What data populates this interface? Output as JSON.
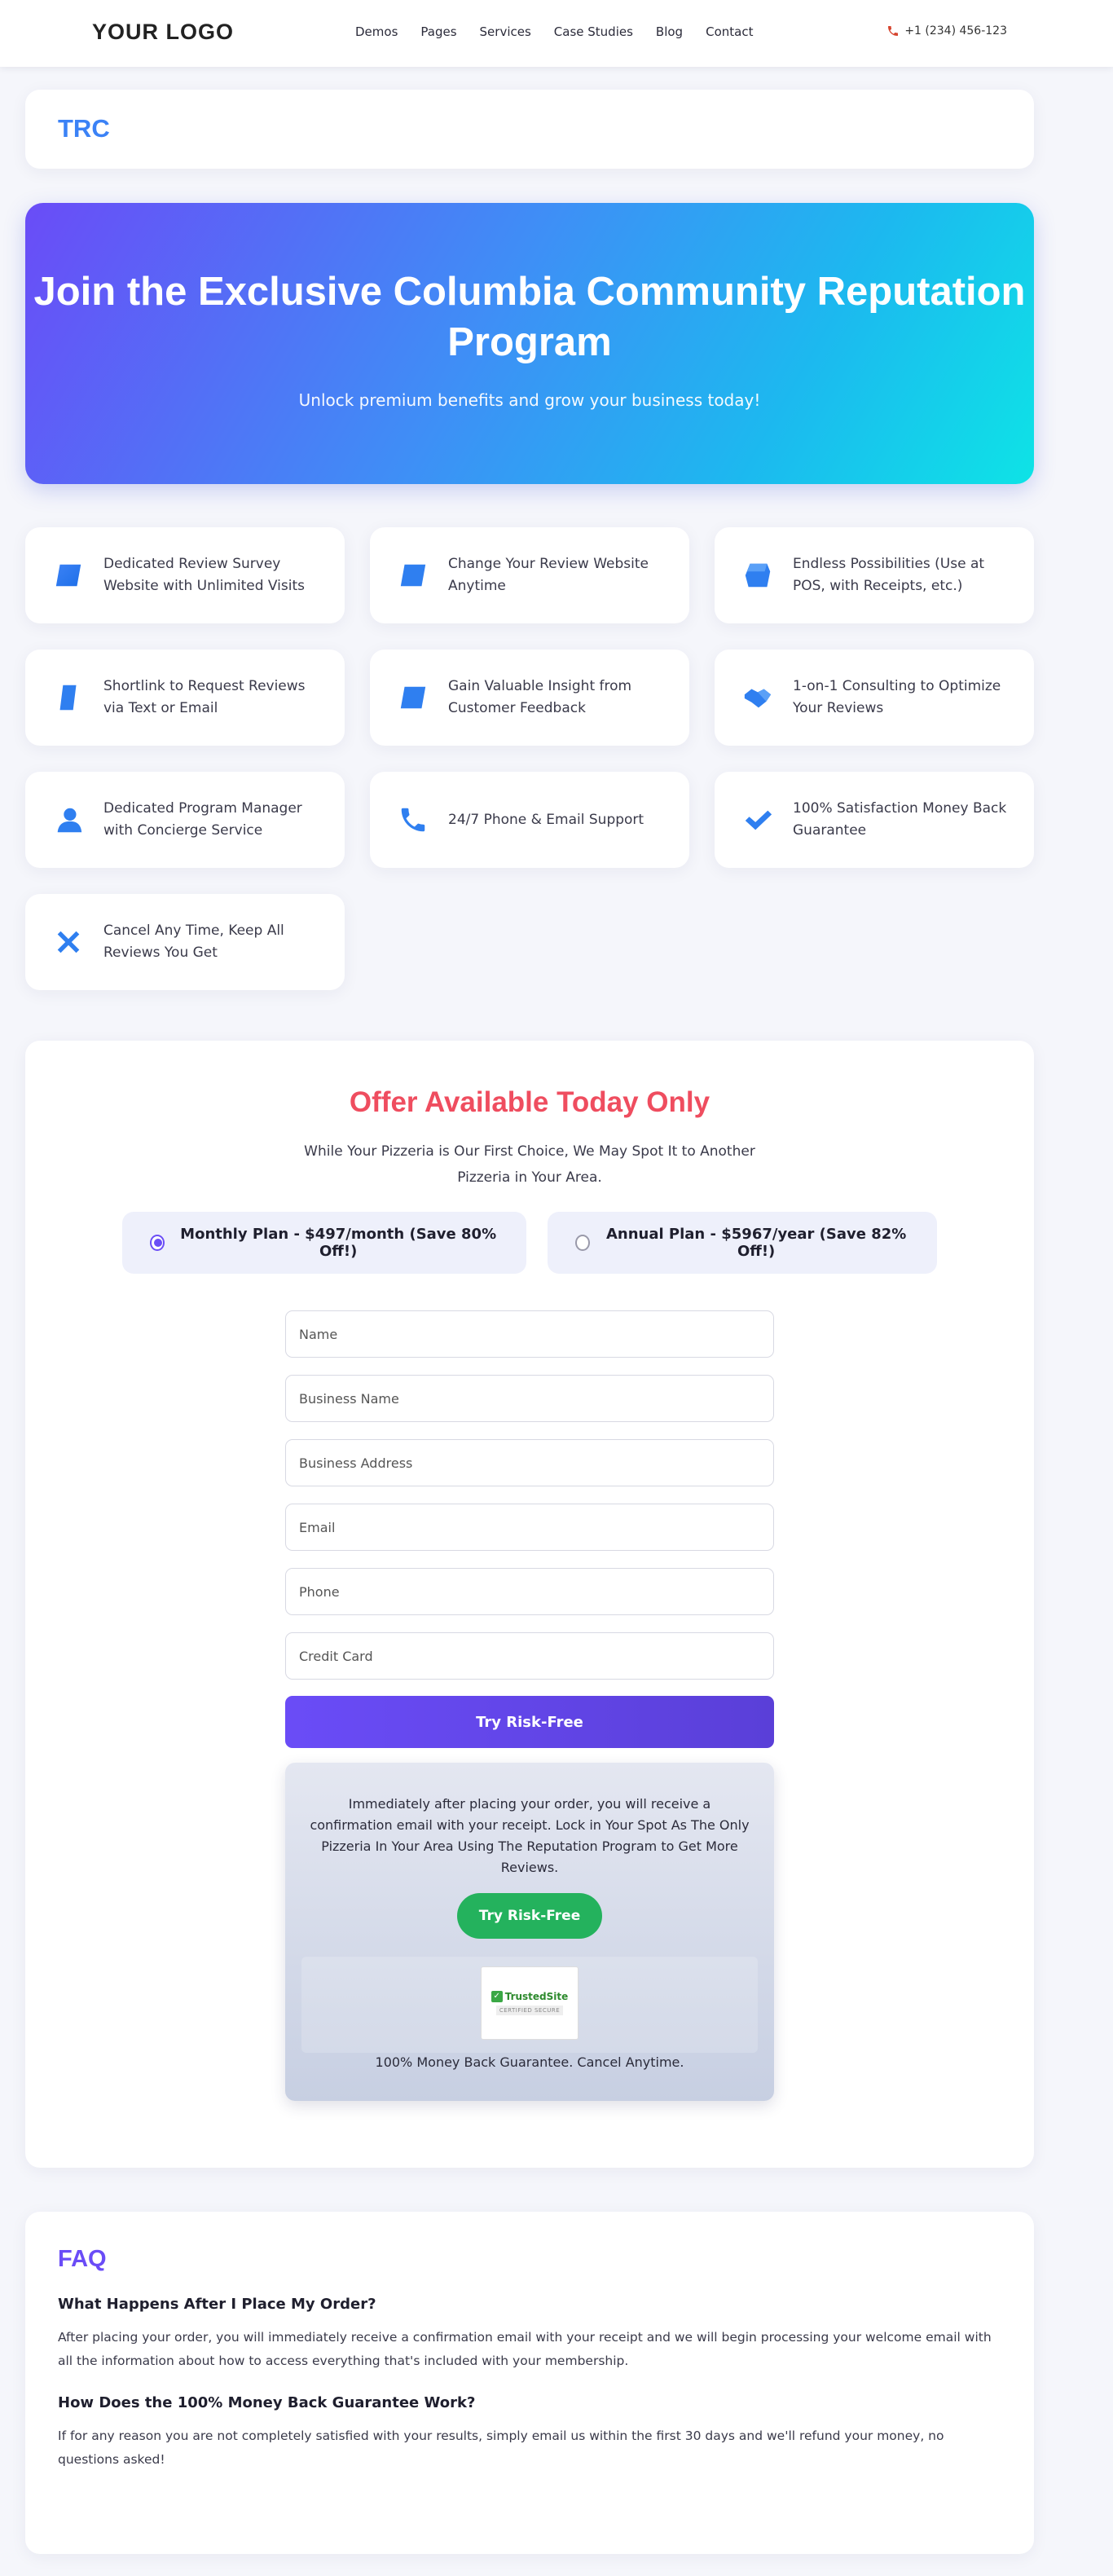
{
  "nav": {
    "logo": "YOUR LOGO",
    "menu": [
      "Demos",
      "Pages",
      "Services",
      "Case Studies",
      "Blog",
      "Contact"
    ],
    "phone": "+1 (234) 456-123"
  },
  "brand": "TRC",
  "hero": {
    "title": "Join the Exclusive Columbia Community Reputation Program",
    "subtitle": "Unlock premium benefits and grow your business today!"
  },
  "features": [
    {
      "icon": "parallelogram-icon",
      "text": "Dedicated Review Survey Website with Unlimited Visits"
    },
    {
      "icon": "parallelogram-icon",
      "text": "Change Your Review Website Anytime"
    },
    {
      "icon": "shape-icon",
      "text": "Endless Possibilities (Use at POS, with Receipts, etc.)"
    },
    {
      "icon": "parallelogram-icon",
      "text": "Shortlink to Request Reviews via Text or Email"
    },
    {
      "icon": "parallelogram-icon",
      "text": "Gain Valuable Insight from Customer Feedback"
    },
    {
      "icon": "handshake-icon",
      "text": "1-on-1 Consulting to Optimize Your Reviews"
    },
    {
      "icon": "user-icon",
      "text": "Dedicated Program Manager with Concierge Service"
    },
    {
      "icon": "phone-icon",
      "text": "24/7 Phone & Email Support"
    },
    {
      "icon": "check-icon",
      "text": "100% Satisfaction Money Back Guarantee"
    },
    {
      "icon": "x-icon",
      "text": "Cancel Any Time, Keep All Reviews You Get"
    }
  ],
  "offer": {
    "title": "Offer Available Today Only",
    "subtitle": "While Your Pizzeria is Our First Choice, We May Spot It to Another Pizzeria in Your Area.",
    "plans": [
      {
        "label": "Monthly Plan - $497/month (Save 80% Off!)",
        "selected": true
      },
      {
        "label": "Annual Plan - $5967/year (Save 82% Off!)",
        "selected": false
      }
    ],
    "fields": {
      "name": "Name",
      "business_name": "Business Name",
      "business_address": "Business Address",
      "email": "Email",
      "phone": "Phone",
      "credit_card": "Credit Card"
    },
    "submit_label": "Try Risk-Free",
    "confirm_text": "Immediately after placing your order, you will receive a confirmation email with your receipt. Lock in Your Spot As The Only Pizzeria In Your Area Using The Reputation Program to Get More Reviews.",
    "confirm_button": "Try Risk-Free",
    "badge": {
      "title": "TrustedSite",
      "subtitle": "CERTIFIED SECURE"
    },
    "guarantee": "100% Money Back Guarantee. Cancel Anytime."
  },
  "faq": {
    "title": "FAQ",
    "items": [
      {
        "q": "What Happens After I Place My Order?",
        "a": "After placing your order, you will immediately receive a confirmation email with your receipt and we will begin processing your welcome email with all the information about how to access everything that's included with your membership."
      },
      {
        "q": "How Does the 100% Money Back Guarantee Work?",
        "a": "If for any reason you are not completely satisfied with your results, simply email us within the first 30 days and we'll refund your money, no questions asked!"
      }
    ]
  },
  "colors": {
    "accent": "#6a4cf7",
    "brand": "#3b82f6",
    "offer_title": "#ef4d5f",
    "cta_green": "#24b25d"
  }
}
